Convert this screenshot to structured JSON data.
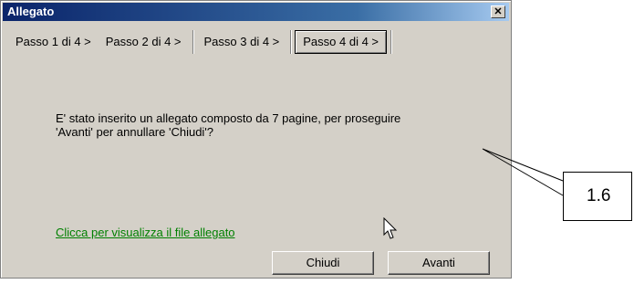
{
  "window": {
    "title": "Allegato",
    "close_label": "✕"
  },
  "tabs": [
    {
      "label": "Passo 1 di 4 >",
      "active": false
    },
    {
      "label": "Passo 2 di 4 >",
      "active": false
    },
    {
      "label": "Passo 3 di 4 >",
      "active": false
    },
    {
      "label": "Passo 4 di 4 >",
      "active": true
    }
  ],
  "message": "E' stato inserito un allegato composto da 7 pagine, per proseguire 'Avanti' per annullare 'Chiudi'?",
  "message_line1": "E' stato inserito un allegato composto da 7 pagine, per proseguire",
  "message_line2": "'Avanti' per annullare 'Chiudi'?",
  "link": "Clicca per visualizza il file allegato",
  "buttons": {
    "close": "Chiudi",
    "next": "Avanti"
  },
  "callout": {
    "label": "1.6"
  },
  "colors": {
    "titlebar": "#0a246a",
    "dialog_bg": "#d4d0c8",
    "link": "#008000"
  }
}
